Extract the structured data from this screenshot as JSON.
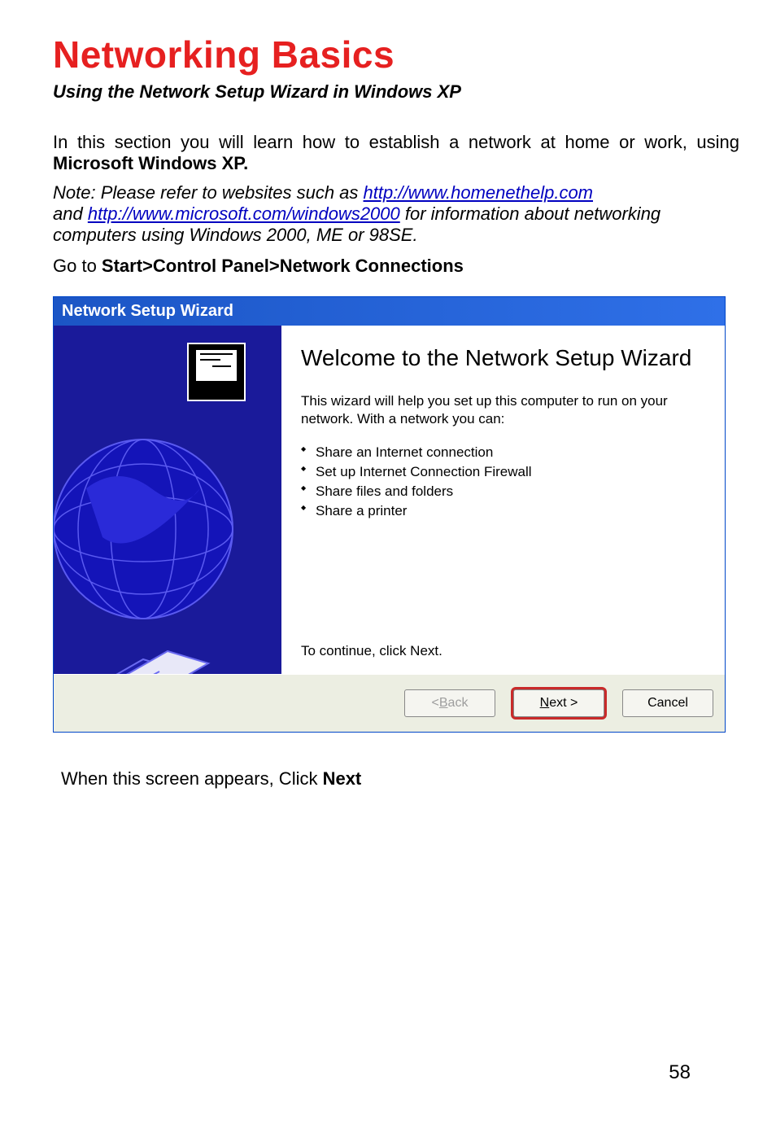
{
  "doc": {
    "title": "Networking Basics",
    "subtitle": "Using the Network Setup Wizard in Windows XP",
    "p1a": "In this section you will learn how to establish a network at home or work, using ",
    "p1b": "Microsoft Windows XP.",
    "note_a": "Note:  Please refer to websites such as ",
    "note_link1": "http://www.homenethelp.com",
    "note_b": "and ",
    "note_link2": "http://www.microsoft.com/windows2000",
    "note_c": "  for information about networking computers using Windows 2000, ME or 98SE.",
    "goto_a": "Go to ",
    "goto_b": "Start>Control Panel>Network Connections",
    "after_a": "When this screen appears, Click ",
    "after_b": "Next",
    "page_number": "58"
  },
  "wizard": {
    "title": "Network Setup Wizard",
    "heading": "Welcome to the Network Setup Wizard",
    "intro": "This wizard will help you set up this computer to run on your network. With a network you can:",
    "bullets": [
      "Share an Internet connection",
      "Set up Internet Connection Firewall",
      "Share files and folders",
      "Share a printer"
    ],
    "continue_text": "To continue, click Next.",
    "back_prefix": "< ",
    "back_u": "B",
    "back_rest": "ack",
    "next_u": "N",
    "next_rest": "ext >",
    "cancel": "Cancel"
  }
}
